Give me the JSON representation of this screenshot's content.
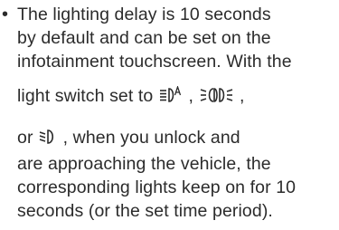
{
  "bullet": "•",
  "note": {
    "line1": "The lighting delay is 10 seconds",
    "line2": "by default and can be set on the",
    "line3": "infotainment touchscreen. With the",
    "line4_text": "light switch set to",
    "line4_sep1": ",",
    "line4_sep2": ",",
    "line5_prefix": "or",
    "line5_text": ", when you unlock and",
    "line6": "are approaching the vehicle, the",
    "line7": "corresponding lights keep on for 10",
    "line8": "seconds (or the set time period)."
  },
  "icons": {
    "auto_headlight": "auto-headlight-icon",
    "parking_light": "parking-light-icon",
    "low_beam": "low-beam-icon"
  }
}
